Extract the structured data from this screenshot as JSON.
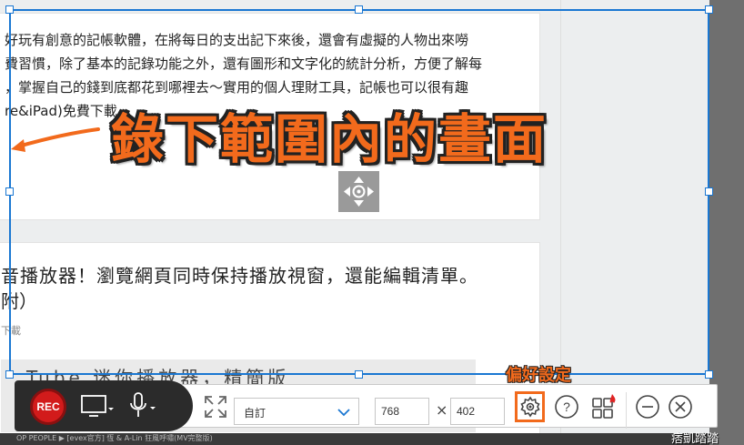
{
  "page": {
    "paragraph": [
      "好玩有創意的記帳軟體，在將每日的支出記下來後，還會有虛擬的人物出來嘮",
      "費習慣，除了基本的記錄功能之外，還有圖形和文字化的統計分析，方便了解每",
      "，掌握自己的錢到底都花到哪裡去～實用的個人理財工具，記帳也可以很有趣",
      "re&iPad)免費下載"
    ],
    "article_title_1": "音播放器！瀏覽網頁同時保持播放視窗，還能編輯清單。",
    "article_title_2": "附）",
    "article_meta": "下載",
    "banner_text": "Tube 迷你播放器，精簡版"
  },
  "annotations": {
    "capture_label": "錄下範圍內的畫面",
    "preferences_label": "偏好設定",
    "accent_color": "#f26a1c"
  },
  "recorder": {
    "rec_label": "REC",
    "size_preset": "自訂",
    "width": "768",
    "height": "402",
    "times_symbol": "×"
  },
  "watermark": "痞凱踏踏",
  "taskbar_text": "OP PEOPLE   ▶  [evex官方] 恆 & A-Lin 狂風呼嘯(MV完整版)",
  "icons": [
    "screen-icon",
    "microphone-icon",
    "fullscreen-icon",
    "chevron-down-icon",
    "gear-icon",
    "help-icon",
    "apps-icon",
    "minimize-icon",
    "close-icon",
    "move-icon",
    "arrow-icon"
  ]
}
